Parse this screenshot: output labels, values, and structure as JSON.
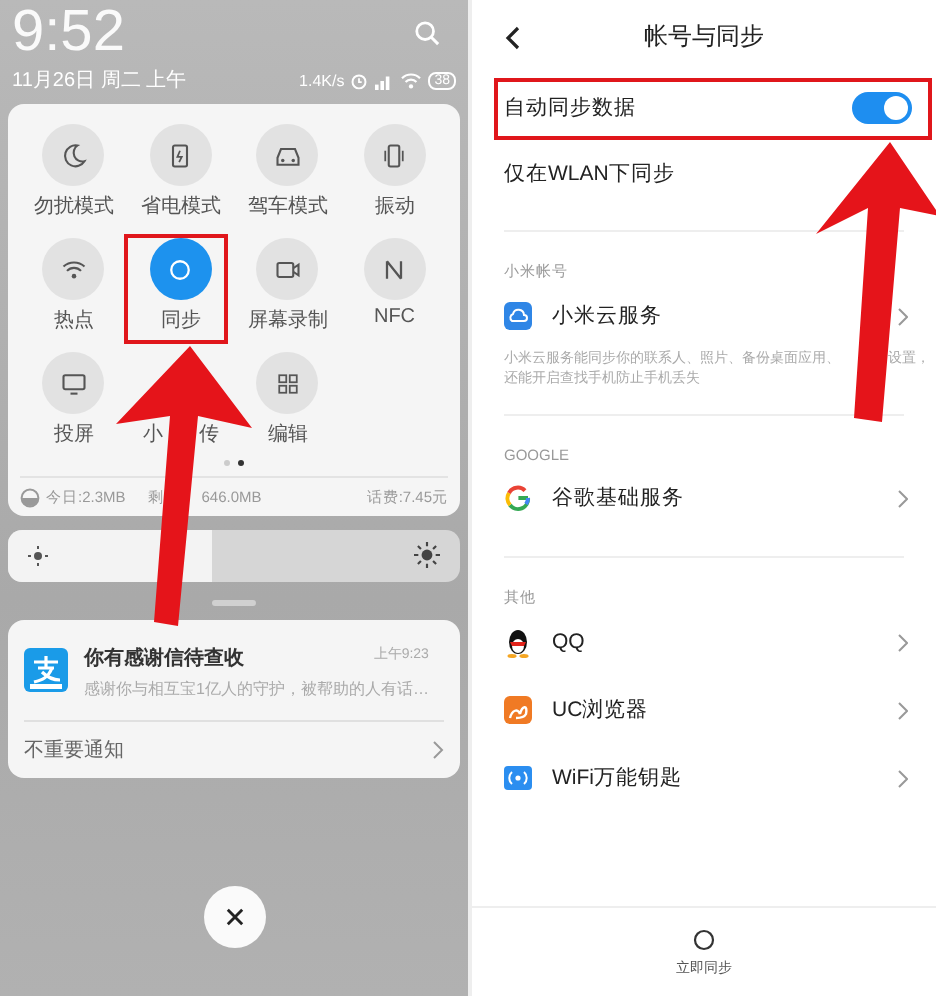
{
  "left_screen": {
    "status_bar": {
      "time": "9:52",
      "date": "11月26日 周二 上午",
      "network_speed": "1.4K/s",
      "battery": "38"
    },
    "quick_toggles": [
      {
        "label": "勿扰模式",
        "on": false
      },
      {
        "label": "省电模式",
        "on": false
      },
      {
        "label": "驾车模式",
        "on": false
      },
      {
        "label": "振动",
        "on": false
      },
      {
        "label": "热点",
        "on": false
      },
      {
        "label": "同步",
        "on": true
      },
      {
        "label": "屏幕录制",
        "on": false
      },
      {
        "label": "NFC",
        "on": false
      },
      {
        "label": "投屏",
        "on": false
      },
      {
        "kind": "covered",
        "label_parts": [
          "小",
          "传"
        ]
      },
      {
        "label": "编辑",
        "on": false
      }
    ],
    "page_dots": [
      {
        "selected": false
      },
      {
        "selected": true
      }
    ],
    "data_usage": {
      "today": "今日:2.3MB",
      "remaining": "剩",
      "remaining_value": "646.0MB",
      "phone_bill": "话费:7.45元"
    },
    "brightness": {
      "level": 0.45
    },
    "notification": {
      "title": "你有感谢信待查收",
      "time": "上午9:23",
      "body": "感谢你与相互宝1亿人的守护，被帮助的人有话…",
      "footer": "不重要通知"
    }
  },
  "right_screen": {
    "title": "帐号与同步",
    "toggles": [
      {
        "label": "自动同步数据",
        "on": true
      },
      {
        "label": "仅在WLAN下同步"
      }
    ],
    "sections": [
      {
        "header": "小米帐号",
        "items": [
          {
            "label": "小米云服务",
            "description_lines": [
              "小米云服务能同步你的联系人、照片、备份桌面应用、",
              "设置，",
              "还能开启查找手机防止手机丢失"
            ]
          }
        ]
      },
      {
        "header": "GOOGLE",
        "items": [
          {
            "label": "谷歌基础服务"
          }
        ]
      },
      {
        "header": "其他",
        "items": [
          {
            "label": "QQ"
          },
          {
            "label": "UC浏览器"
          },
          {
            "label": "WiFi万能钥匙"
          }
        ]
      }
    ],
    "sync_now": "立即同步"
  }
}
